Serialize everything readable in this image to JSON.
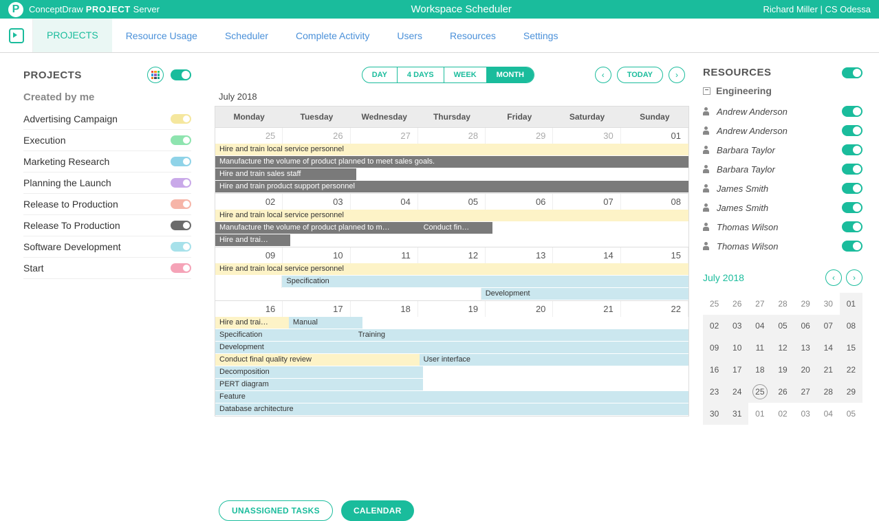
{
  "brand": {
    "cd": "ConceptDraw",
    "pr": "PROJECT",
    "sv": "Server"
  },
  "page_title": "Workspace Scheduler",
  "user_label": "Richard Miller | CS Odessa",
  "nav": {
    "projects": "PROJECTS",
    "resource_usage": "Resource Usage",
    "scheduler": "Scheduler",
    "complete_activity": "Complete Activity",
    "users": "Users",
    "resources": "Resources",
    "settings": "Settings"
  },
  "left": {
    "heading": "PROJECTS",
    "subhead": "Created by me",
    "projects": [
      {
        "name": "Advertising Campaign",
        "color": "#f5e79e"
      },
      {
        "name": "Execution",
        "color": "#8ee4af"
      },
      {
        "name": "Marketing Research",
        "color": "#8fd3e8"
      },
      {
        "name": "Planning the Launch",
        "color": "#c9a9e9"
      },
      {
        "name": "Release to Production",
        "color": "#f6b5a8"
      },
      {
        "name": "Release To Production",
        "color": "#6b6b6b"
      },
      {
        "name": "Software Development",
        "color": "#a7e1ea"
      },
      {
        "name": "Start",
        "color": "#f5a3b7"
      }
    ]
  },
  "mid": {
    "views": {
      "day": "DAY",
      "four_days": "4 DAYS",
      "week": "WEEK",
      "month": "MONTH"
    },
    "today": "TODAY",
    "month_label": "July 2018",
    "day_headers": [
      "Monday",
      "Tuesday",
      "Wednesday",
      "Thursday",
      "Friday",
      "Saturday",
      "Sunday"
    ],
    "weeks": [
      {
        "dates": [
          "25",
          "26",
          "27",
          "28",
          "29",
          "30",
          "01"
        ],
        "in_month": [
          false,
          false,
          false,
          false,
          false,
          false,
          true
        ],
        "bars": [
          {
            "text": "Hire and train local service personnel",
            "cls": "yellow",
            "start": 0,
            "span": 7
          },
          {
            "text": "Manufacture the volume of product planned to meet sales goals.",
            "cls": "gray",
            "start": 0,
            "span": 7
          },
          {
            "text": "Hire and train sales staff",
            "cls": "gray",
            "start": 0,
            "span": 2
          },
          {
            "text": "Hire and train product support personnel",
            "cls": "gray",
            "start": 0,
            "span": 7
          }
        ]
      },
      {
        "dates": [
          "02",
          "03",
          "04",
          "05",
          "06",
          "07",
          "08"
        ],
        "in_month": [
          true,
          true,
          true,
          true,
          true,
          true,
          true
        ],
        "bars": [
          {
            "text": "Hire and train local service personnel",
            "cls": "yellow",
            "start": 0,
            "span": 7
          },
          {
            "text": "Manufacture the volume of product planned to m…",
            "cls": "gray",
            "start": 0,
            "span": 3
          },
          {
            "text": "Conduct fin…",
            "cls": "gray",
            "start": 3,
            "span": 1,
            "same_row": true
          },
          {
            "text": "Hire and trai…",
            "cls": "gray",
            "start": 0,
            "span": 1
          }
        ]
      },
      {
        "dates": [
          "09",
          "10",
          "11",
          "12",
          "13",
          "14",
          "15"
        ],
        "in_month": [
          true,
          true,
          true,
          true,
          true,
          true,
          true
        ],
        "bars": [
          {
            "text": "Hire and train local service personnel",
            "cls": "yellow",
            "start": 0,
            "span": 7
          },
          {
            "text": "Specification",
            "cls": "blue",
            "start": 1,
            "span": 6
          },
          {
            "text": "Development",
            "cls": "blue",
            "start": 4,
            "span": 3
          }
        ]
      },
      {
        "dates": [
          "16",
          "17",
          "18",
          "19",
          "20",
          "21",
          "22"
        ],
        "in_month": [
          true,
          true,
          true,
          true,
          true,
          true,
          true
        ],
        "bars": [
          {
            "text": "Hire and trai…",
            "cls": "yellow",
            "start": 0,
            "span": 1
          },
          {
            "text": "Manual",
            "cls": "blue",
            "start": 1,
            "span": 1,
            "same_row": true
          },
          {
            "text": "Specification",
            "cls": "blue",
            "start": 0,
            "span": 2
          },
          {
            "text": "Training",
            "cls": "blue",
            "start": 2,
            "span": 5,
            "same_row": true
          },
          {
            "text": "Development",
            "cls": "blue",
            "start": 0,
            "span": 7
          },
          {
            "text": "Conduct final quality review",
            "cls": "yellow",
            "start": 0,
            "span": 3
          },
          {
            "text": "User interface",
            "cls": "blue",
            "start": 3,
            "span": 4,
            "same_row": true
          },
          {
            "text": "Decomposition",
            "cls": "blue",
            "start": 0,
            "span": 3
          },
          {
            "text": "PERT diagram",
            "cls": "blue",
            "start": 0,
            "span": 3
          },
          {
            "text": "Feature",
            "cls": "blue",
            "start": 0,
            "span": 7
          },
          {
            "text": "Database architecture",
            "cls": "blue",
            "start": 0,
            "span": 7
          }
        ]
      }
    ],
    "bottom": {
      "unassigned": "UNASSIGNED TASKS",
      "calendar": "CALENDAR"
    }
  },
  "right": {
    "heading": "RESOURCES",
    "group": "Engineering",
    "people": [
      "Andrew Anderson",
      "Andrew Anderson",
      "Barbara Taylor",
      "Barbara Taylor",
      "James Smith",
      "James Smith",
      "Thomas Wilson",
      "Thomas Wilson"
    ],
    "mini_month": "July 2018",
    "mini_days": [
      {
        "n": "25"
      },
      {
        "n": "26"
      },
      {
        "n": "27"
      },
      {
        "n": "28"
      },
      {
        "n": "29"
      },
      {
        "n": "30"
      },
      {
        "n": "01",
        "in": true
      },
      {
        "n": "02",
        "in": true
      },
      {
        "n": "03",
        "in": true
      },
      {
        "n": "04",
        "in": true
      },
      {
        "n": "05",
        "in": true
      },
      {
        "n": "06",
        "in": true
      },
      {
        "n": "07",
        "in": true
      },
      {
        "n": "08",
        "in": true
      },
      {
        "n": "09",
        "in": true
      },
      {
        "n": "10",
        "in": true
      },
      {
        "n": "11",
        "in": true
      },
      {
        "n": "12",
        "in": true
      },
      {
        "n": "13",
        "in": true
      },
      {
        "n": "14",
        "in": true
      },
      {
        "n": "15",
        "in": true
      },
      {
        "n": "16",
        "in": true
      },
      {
        "n": "17",
        "in": true
      },
      {
        "n": "18",
        "in": true
      },
      {
        "n": "19",
        "in": true
      },
      {
        "n": "20",
        "in": true
      },
      {
        "n": "21",
        "in": true
      },
      {
        "n": "22",
        "in": true
      },
      {
        "n": "23",
        "in": true
      },
      {
        "n": "24",
        "in": true
      },
      {
        "n": "25",
        "in": true,
        "today": true
      },
      {
        "n": "26",
        "in": true
      },
      {
        "n": "27",
        "in": true
      },
      {
        "n": "28",
        "in": true
      },
      {
        "n": "29",
        "in": true
      },
      {
        "n": "30",
        "in": true
      },
      {
        "n": "31",
        "in": true
      },
      {
        "n": "01"
      },
      {
        "n": "02"
      },
      {
        "n": "03"
      },
      {
        "n": "04"
      },
      {
        "n": "05"
      }
    ]
  }
}
